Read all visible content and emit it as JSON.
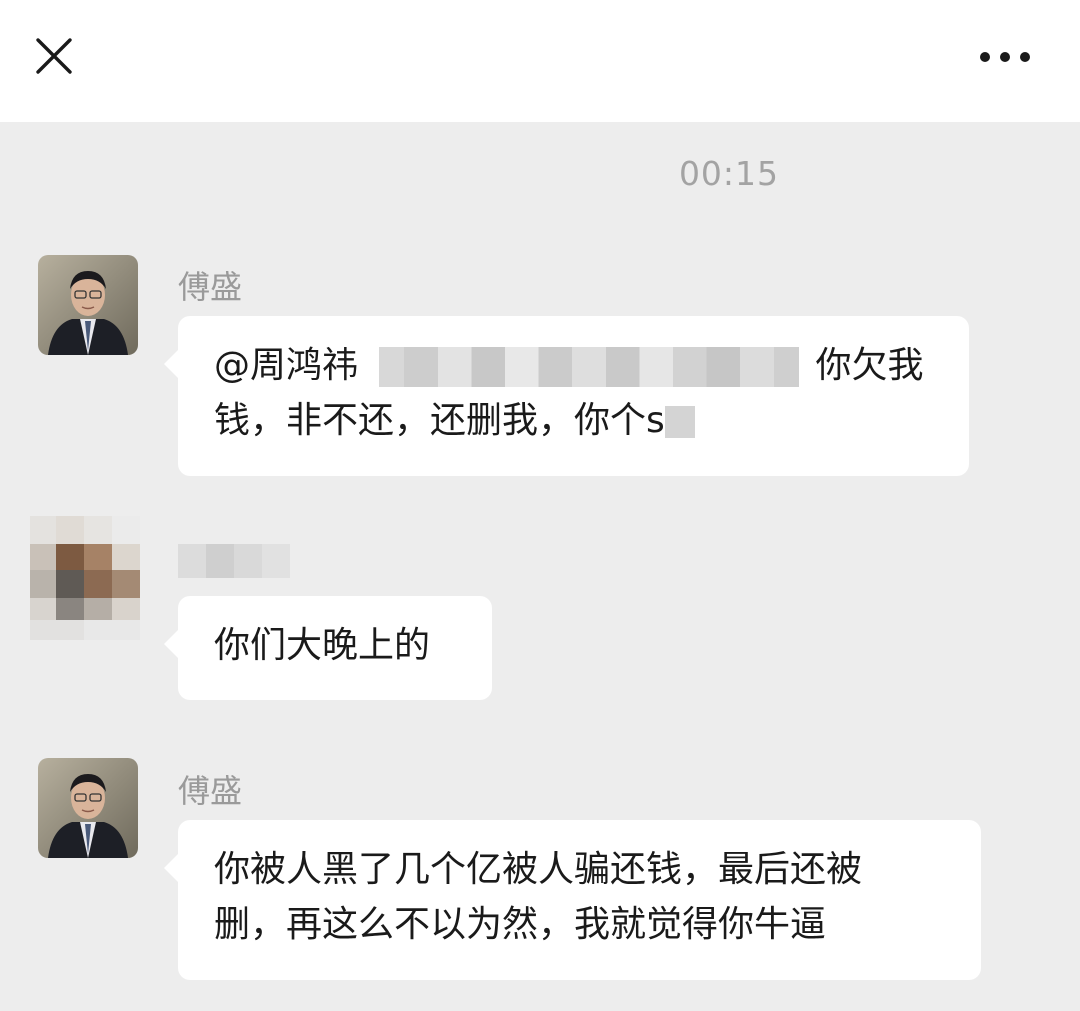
{
  "header": {
    "close_icon": "close-icon",
    "more_icon": "more-icon"
  },
  "chat": {
    "timestamp": "00:15",
    "messages": [
      {
        "sender": "傅盛",
        "line1_prefix": "@周鸿祎 ",
        "line1_suffix": "你欠我",
        "line2": "钱，非不还，还删我，你个s"
      },
      {
        "sender": "",
        "text": "你们大晚上的"
      },
      {
        "sender": "傅盛",
        "line1": "你被人黑了几个亿被人骗还钱，最后还被",
        "line2": "删，再这么不以为然，我就觉得你牛逼"
      }
    ]
  },
  "colors": {
    "background": "#ededed",
    "header": "#ffffff",
    "bubble": "#ffffff",
    "sender_name": "#9a9a9a",
    "timestamp": "#a3a3a3"
  }
}
